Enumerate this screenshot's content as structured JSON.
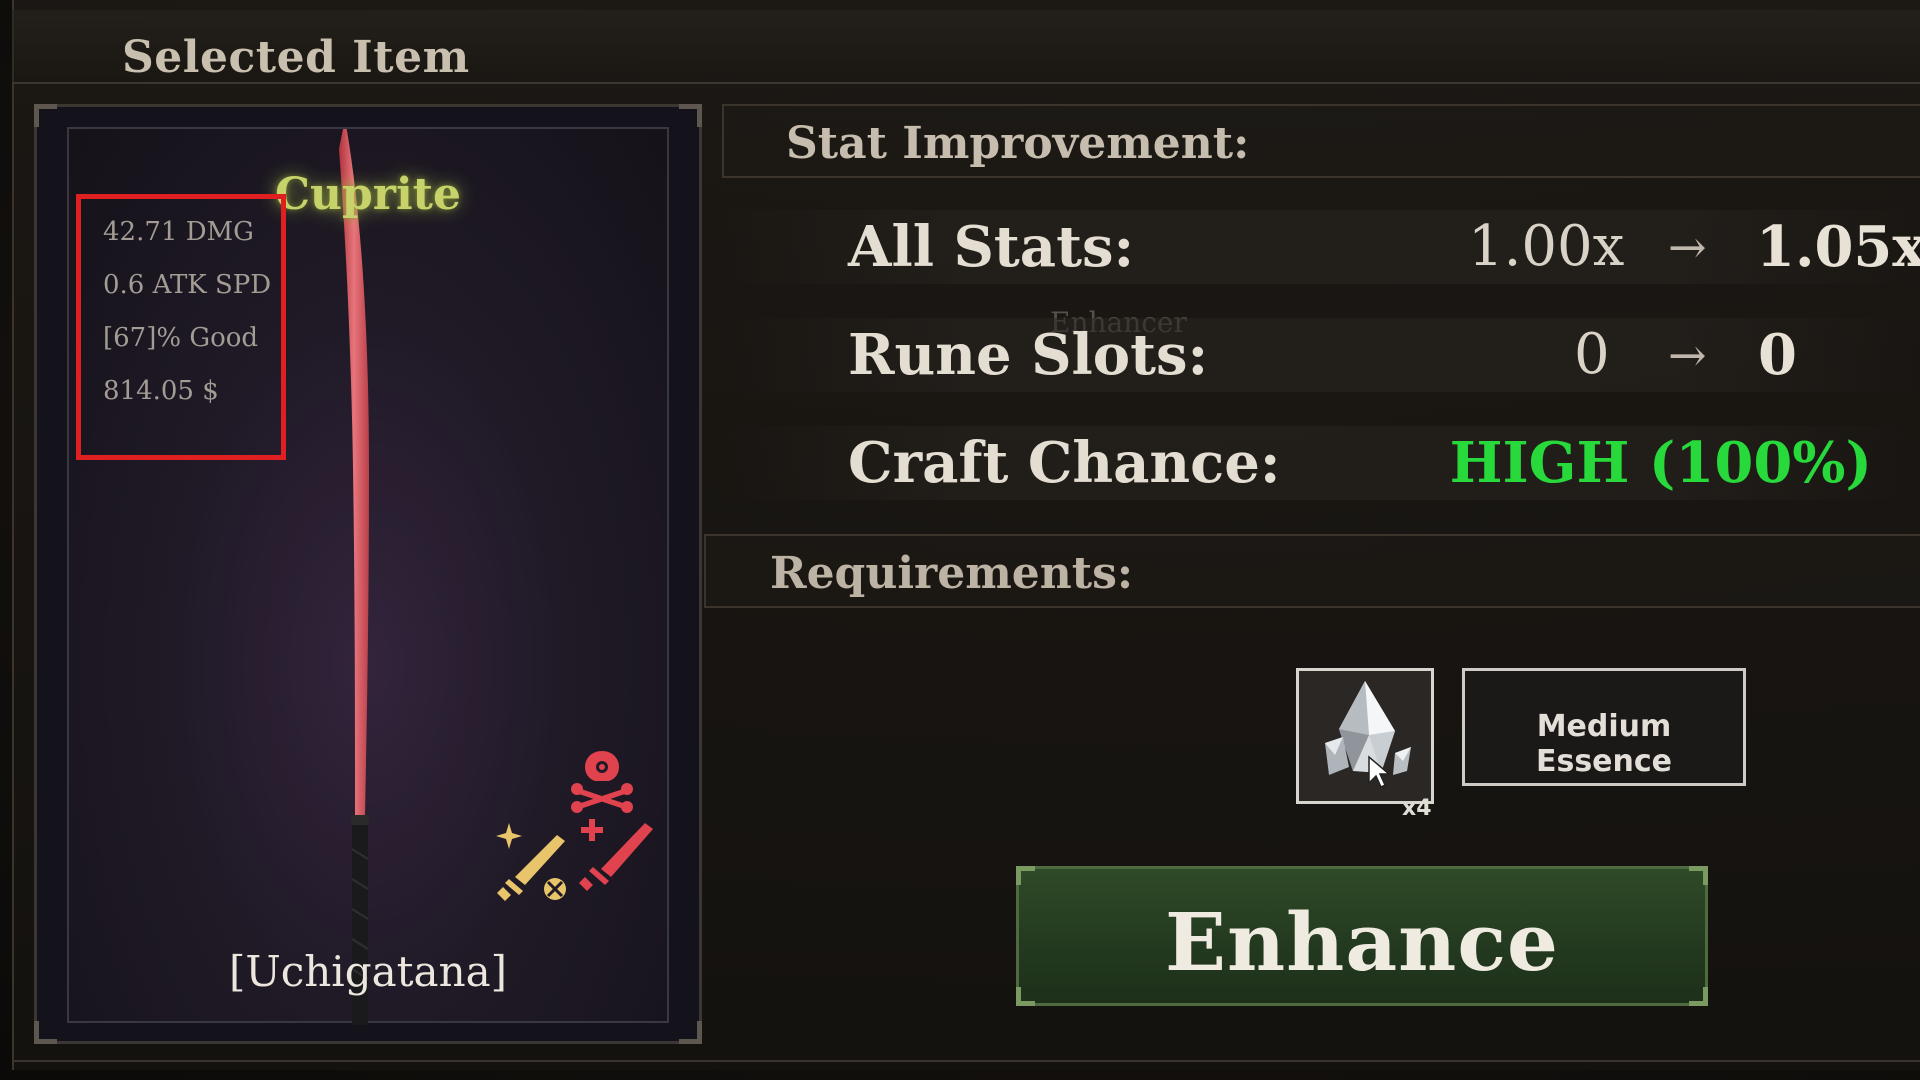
{
  "header": {
    "title": "Selected Item"
  },
  "item": {
    "rarity": "Cuprite",
    "name": "[Uchigatana]",
    "stats": [
      "42.71 DMG",
      "0.6 ATK SPD",
      "[67]% Good",
      "814.05 $"
    ],
    "rarity_color": "#c7d36a",
    "blade_color": "#e35a62",
    "trait_icons": [
      "crossbones-icon",
      "sparkle-sword-icon",
      "plus-sword-icon"
    ]
  },
  "stat_improvement": {
    "title": "Stat Improvement:",
    "rows": [
      {
        "label": "All Stats:",
        "from": "1.00x",
        "to": "1.05x"
      },
      {
        "label": "Rune Slots:",
        "from": "0",
        "to": "0"
      }
    ],
    "craft_chance": {
      "label": "Craft Chance:",
      "value": "HIGH (100%)",
      "color": "#27d93a"
    },
    "arrow": "→",
    "ghost_label": "Enhancer"
  },
  "requirements": {
    "title": "Requirements:",
    "items": [
      {
        "name": "Medium Essence",
        "quantity": "x4",
        "icon": "crystal-icon"
      }
    ]
  },
  "actions": {
    "enhance_label": "Enhance"
  }
}
